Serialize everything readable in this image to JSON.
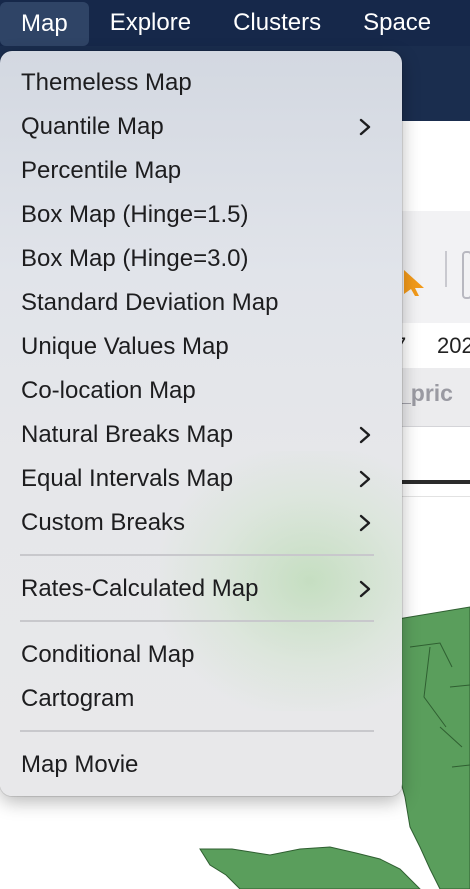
{
  "menubar": {
    "items": [
      {
        "label": "Map",
        "active": true
      },
      {
        "label": "Explore",
        "active": false
      },
      {
        "label": "Clusters",
        "active": false
      },
      {
        "label": "Space",
        "active": false
      }
    ]
  },
  "background": {
    "cell_1": "7",
    "cell_2": "202",
    "column_header": "_pric"
  },
  "menu": {
    "items": [
      {
        "label": "Themeless Map",
        "has_submenu": false
      },
      {
        "label": "Quantile Map",
        "has_submenu": true
      },
      {
        "label": "Percentile Map",
        "has_submenu": false
      },
      {
        "label": "Box Map (Hinge=1.5)",
        "has_submenu": false
      },
      {
        "label": "Box Map (Hinge=3.0)",
        "has_submenu": false
      },
      {
        "label": "Standard Deviation Map",
        "has_submenu": false
      },
      {
        "label": "Unique Values Map",
        "has_submenu": false
      },
      {
        "label": "Co-location Map",
        "has_submenu": false
      },
      {
        "label": "Natural Breaks Map",
        "has_submenu": true
      },
      {
        "label": "Equal Intervals Map",
        "has_submenu": true
      },
      {
        "label": "Custom Breaks",
        "has_submenu": true
      },
      {
        "label": "Rates-Calculated Map",
        "has_submenu": true
      },
      {
        "label": "Conditional Map",
        "has_submenu": false
      },
      {
        "label": "Cartogram",
        "has_submenu": false
      },
      {
        "label": "Map Movie",
        "has_submenu": false
      }
    ]
  },
  "colors": {
    "menubar_bg": "#16284a",
    "map_fill": "#5a9e5c",
    "icon_orange": "#f29a1a",
    "icon_purple": "#8a4fc8"
  },
  "icons": {
    "submenu": "chevron-right-icon",
    "toolbar_tool": "cursor-select-icon",
    "map": "florida-map-shape"
  }
}
